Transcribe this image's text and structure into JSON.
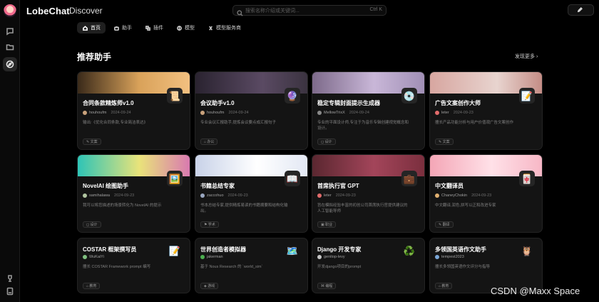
{
  "app": {
    "logo": "LobeChat",
    "section": "Discover"
  },
  "search": {
    "placeholder": "搜索名称介绍或关键词...",
    "shortcut": "Ctrl K",
    "icon": "search-icon"
  },
  "header": {
    "submit_label": "",
    "submit_icon": "edit-icon"
  },
  "tabs": [
    {
      "label": "首页",
      "icon": "home-icon",
      "active": true
    },
    {
      "label": "助手",
      "icon": "bot-icon"
    },
    {
      "label": "插件",
      "icon": "puzzle-icon"
    },
    {
      "label": "模型",
      "icon": "brain-icon"
    },
    {
      "label": "模型服务商",
      "icon": "server-icon"
    }
  ],
  "section_title": "推荐助手",
  "more_link": "发现更多",
  "cards": [
    {
      "title": "合同条款精炼师v1.0",
      "author": "houhoufm",
      "date": "2024-09-24",
      "desc": "输出:《优化合同条款,专业简洁表达》",
      "tag": "文案",
      "emoji": "📜"
    },
    {
      "title": "会议助手v1.0",
      "author": "houhoufm",
      "date": "2024-09-24",
      "desc": "专业会议汇报助手,提炼会议要点成汇报句子",
      "tag": "办公",
      "emoji": "🔮"
    },
    {
      "title": "稳定专辑封面提示生成器",
      "author": "MellowTrixX",
      "date": "2024-09-24",
      "desc": "专业的平面设计师,专注于为音乐专辑创建视觉概念和设计。",
      "tag": "设计",
      "emoji": "💿"
    },
    {
      "title": "广告文案创作大师",
      "author": "leter",
      "date": "2024-09-23",
      "desc": "擅长产品功能分析与用户价值观广告文案创作",
      "tag": "文案",
      "emoji": "📝"
    },
    {
      "title": "NovelAI 绘图助手",
      "author": "samihalawa",
      "date": "2024-09-23",
      "desc": "我可以将您描述的场景转化为 NovelAI 的提示",
      "tag": "设计",
      "emoji": "🖼️"
    },
    {
      "title": "书籍总结专家",
      "author": "zaccohuo",
      "date": "2024-09-23",
      "desc": "书本总结专家,提供精炼易读的书籍摘要和结构化输出。",
      "tag": "学术",
      "emoji": "📖"
    },
    {
      "title": "首席执行官 GPT",
      "author": "leter",
      "date": "2024-09-23",
      "desc": "旨在模拟经验丰富的初创公司首席执行官提供建议的人工智能导师",
      "tag": "职业",
      "emoji": "💼"
    },
    {
      "title": "中文翻译员",
      "author": "ChaneyChokin",
      "date": "2024-09-23",
      "desc": "中文翻译,润色,拼写以正和改进专家",
      "tag": "翻译",
      "emoji": "🀄"
    },
    {
      "title": "COSTAR 框架撰写员",
      "author": "WuKaiYi",
      "date": "",
      "desc": "擅长 COSTAR Framework prompt 编写",
      "tag": "教育",
      "emoji": "📝"
    },
    {
      "title": "世界创造者模拟器",
      "author": "jakerman",
      "date": "",
      "desc": "基于 Nous Research 的 `world_sim`",
      "tag": "游戏",
      "emoji": "🗺️"
    },
    {
      "title": "Django 开发专家",
      "author": "genitop-levy",
      "date": "",
      "desc": "开发django项目的prompt",
      "tag": "编程",
      "emoji": "♻️"
    },
    {
      "title": "多领国英语作文助手",
      "author": "tempest2023",
      "date": "",
      "desc": "擅长多领国英语作文评分与指导",
      "tag": "教育",
      "emoji": "🦉"
    }
  ],
  "colors": {
    "background": "#000000",
    "card": "#141414",
    "accent": "#ffffff"
  },
  "watermark": "CSDN @Maxx Space"
}
